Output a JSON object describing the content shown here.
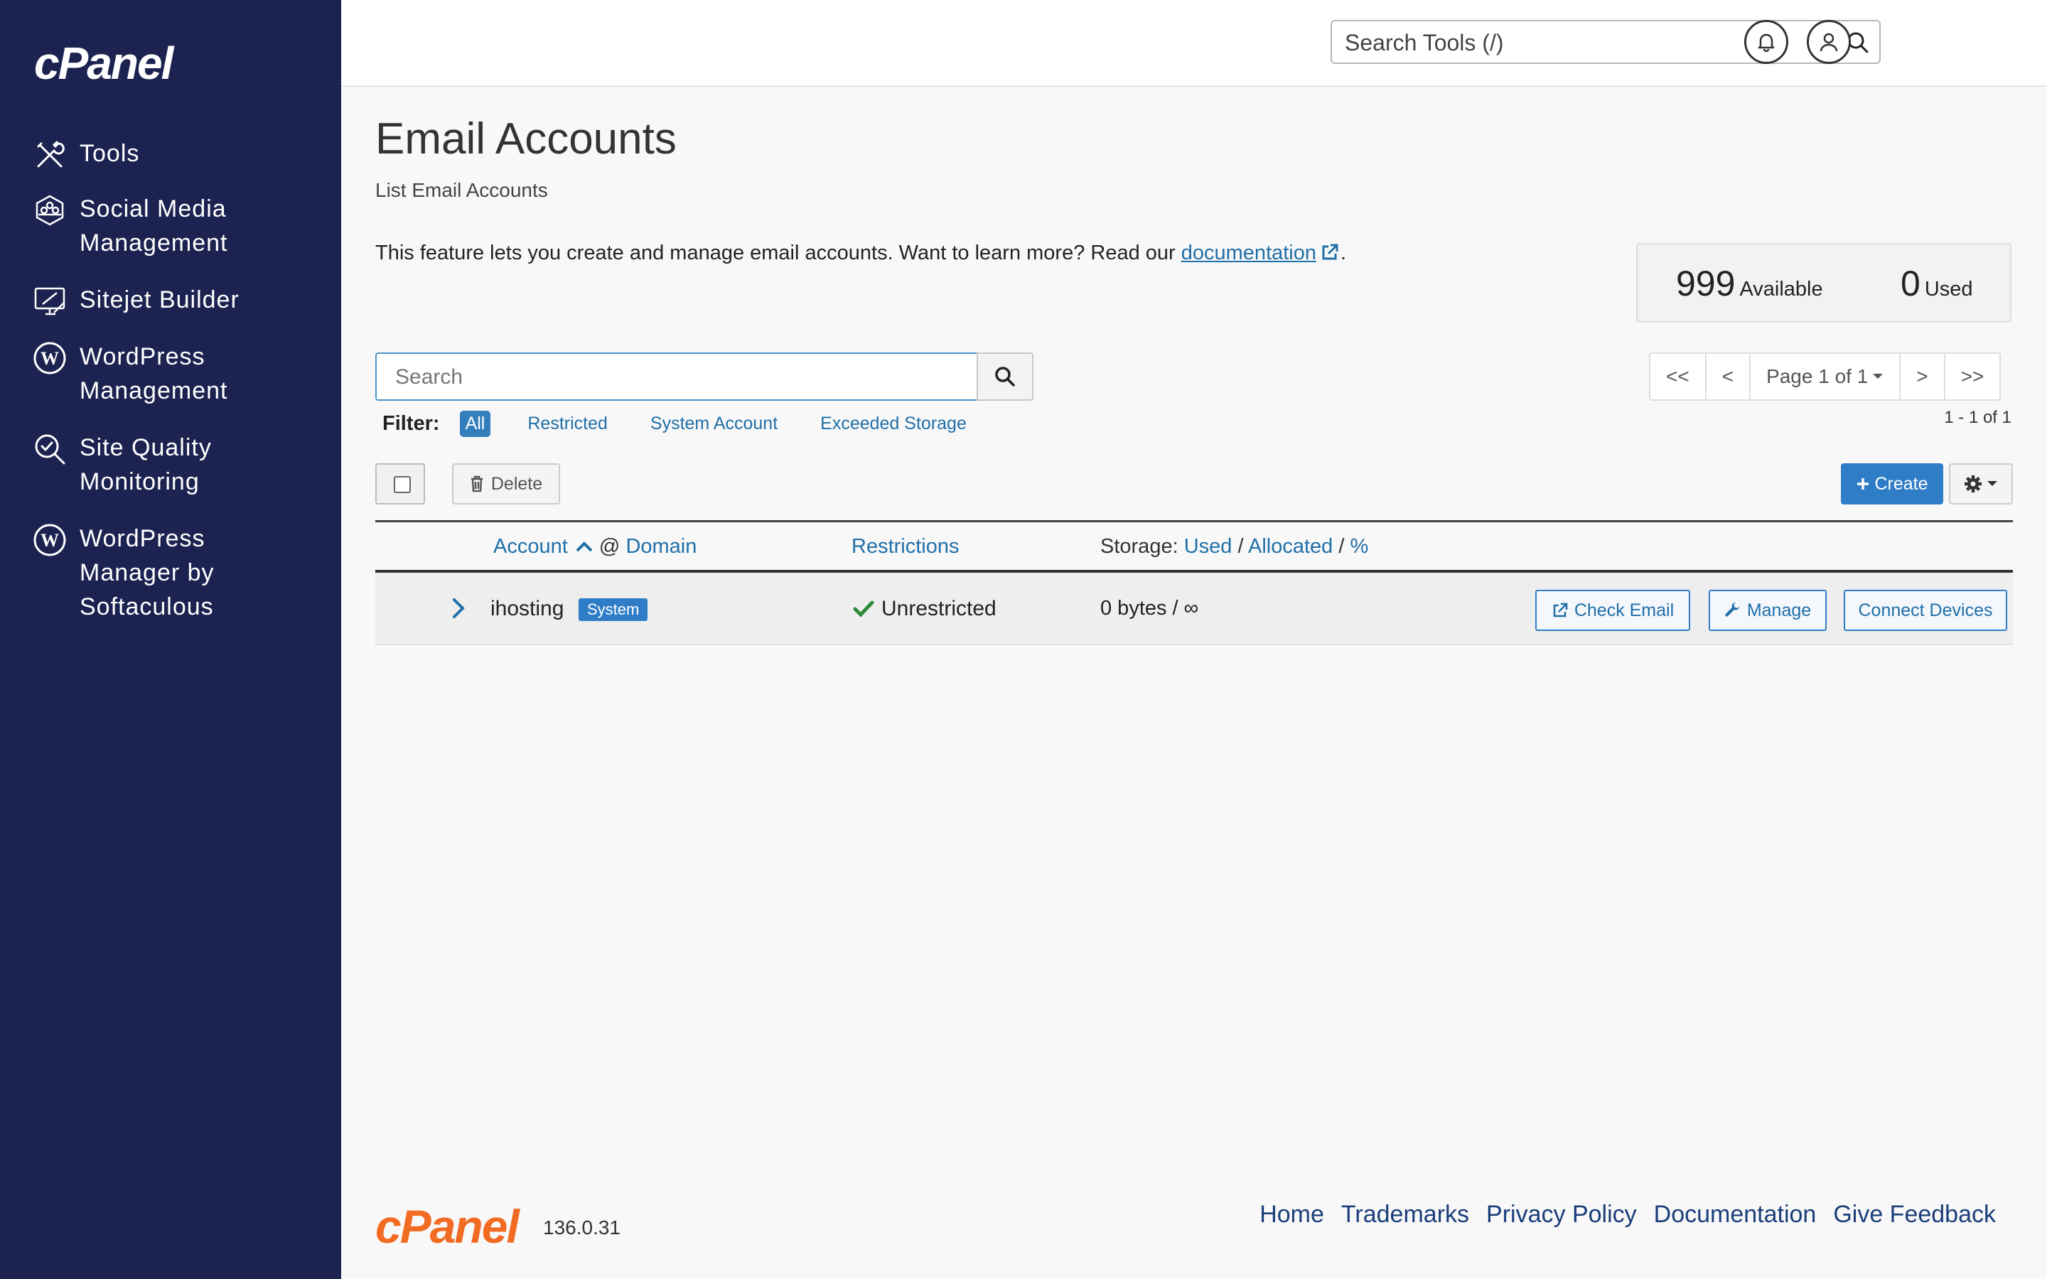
{
  "brand": {
    "logo": "cPanel",
    "footer_logo": "cPanel",
    "version": "136.0.31",
    "sidebar_bg": "#1d2350",
    "accent": "#2f7dc7",
    "footer_logo_color": "#f26b22"
  },
  "sidebar": {
    "items": [
      {
        "label": "Tools",
        "icon": "tools-icon"
      },
      {
        "label": "Social Media Management",
        "icon": "social-media-icon"
      },
      {
        "label": "Sitejet Builder",
        "icon": "sitejet-icon"
      },
      {
        "label": "WordPress Management",
        "icon": "wordpress-icon"
      },
      {
        "label": "Site Quality Monitoring",
        "icon": "site-quality-icon"
      },
      {
        "label": "WordPress Manager by Softaculous",
        "icon": "wordpress-icon"
      }
    ]
  },
  "header": {
    "search_placeholder": "Search Tools (/)"
  },
  "page": {
    "title": "Email Accounts",
    "subtitle": "List Email Accounts",
    "intro": "This feature lets you create and manage email accounts. Want to learn more? Read our",
    "doc_link": "documentation",
    "intro_end": "."
  },
  "stats": {
    "available_num": "999",
    "available_label": "Available",
    "used_num": "0",
    "used_label": "Used"
  },
  "list": {
    "search_placeholder": "Search",
    "filter_label": "Filter:",
    "filters": [
      "All",
      "Restricted",
      "System Account",
      "Exceeded Storage"
    ],
    "active_filter": "All",
    "pager": {
      "first": "<<",
      "prev": "<",
      "page": "Page 1 of 1",
      "next": ">",
      "last": ">>"
    },
    "range": "1 - 1 of 1",
    "delete_label": "Delete",
    "create_label": "Create"
  },
  "table": {
    "col_account": "Account",
    "col_at": "@",
    "col_domain": "Domain",
    "col_restrictions": "Restrictions",
    "col_storage": "Storage:",
    "col_used": "Used",
    "col_allocated": "Allocated",
    "col_percent": "%",
    "slash": "/",
    "rows": [
      {
        "account": "ihosting",
        "badge": "System",
        "restriction": "Unrestricted",
        "storage": "0 bytes / ∞",
        "actions": [
          "Check Email",
          "Manage",
          "Connect Devices"
        ]
      }
    ]
  },
  "footer": {
    "links": [
      "Home",
      "Trademarks",
      "Privacy Policy",
      "Documentation",
      "Give Feedback"
    ]
  }
}
